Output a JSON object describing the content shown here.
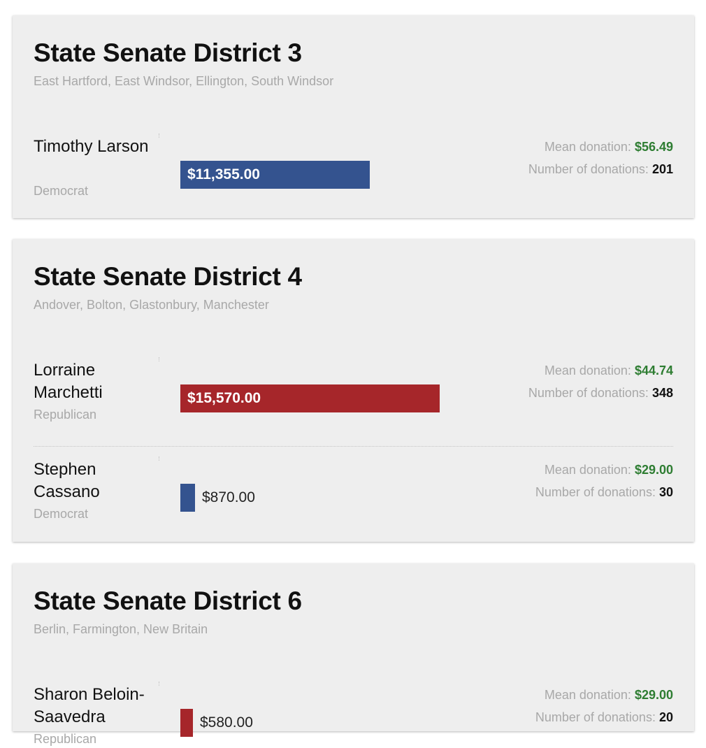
{
  "colors": {
    "democrat": "#34538f",
    "republican": "#a6262a",
    "mean_value": "#2e7d32"
  },
  "labels": {
    "mean_donation": "Mean donation:",
    "number_of_donations": "Number of donations:"
  },
  "bar_scale_max": 19700,
  "districts": [
    {
      "title": "State Senate District 3",
      "towns": "East Hartford, East Windsor, Ellington, South Windsor",
      "candidates": [
        {
          "name": "Timothy Larson",
          "party": "Democrat",
          "total_label": "$11,355.00",
          "total": 11355,
          "mean": "$56.49",
          "count": "201"
        }
      ]
    },
    {
      "title": "State Senate District 4",
      "towns": "Andover, Bolton, Glastonbury, Manchester",
      "candidates": [
        {
          "name": "Lorraine Marchetti",
          "party": "Republican",
          "total_label": "$15,570.00",
          "total": 15570,
          "mean": "$44.74",
          "count": "348"
        },
        {
          "name": "Stephen Cassano",
          "party": "Democrat",
          "total_label": "$870.00",
          "total": 870,
          "mean": "$29.00",
          "count": "30"
        }
      ]
    },
    {
      "title": "State Senate District 6",
      "towns": "Berlin, Farmington, New Britain",
      "candidates": [
        {
          "name": "Sharon Beloin-Saavedra",
          "party": "Republican",
          "total_label": "$580.00",
          "total": 580,
          "mean": "$29.00",
          "count": "20"
        }
      ]
    }
  ]
}
